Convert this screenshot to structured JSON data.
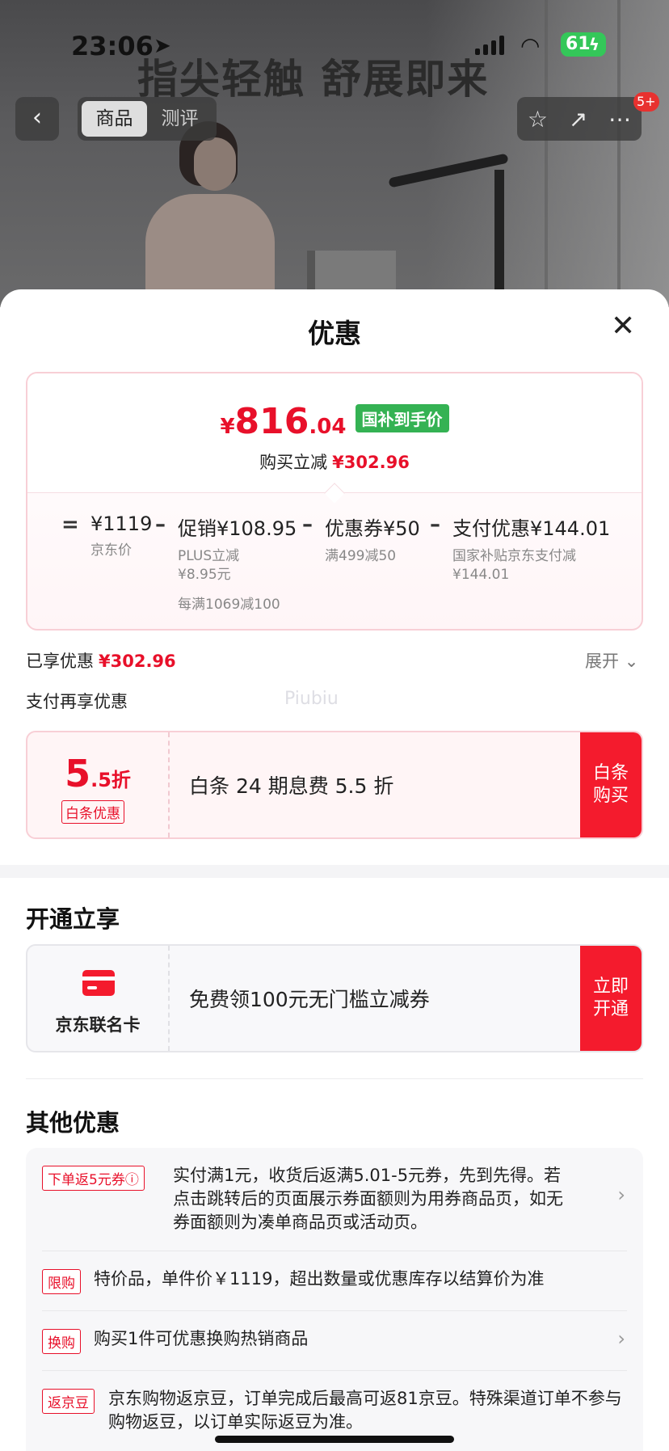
{
  "status_bar": {
    "time": "23:06",
    "battery": "61"
  },
  "hero": {
    "headline": "指尖轻触 舒展即来"
  },
  "nav": {
    "tabs": [
      {
        "label": "商品"
      },
      {
        "label": "测评"
      }
    ],
    "badge": "5+"
  },
  "sheet": {
    "title": "优惠",
    "price": {
      "currency": "¥",
      "integer": "816",
      "decimal": ".04",
      "tag": "国补到手价",
      "sub_label": "购买立减",
      "sub_amount": "¥302.96"
    },
    "breakdown": {
      "eq": "=",
      "base": {
        "main": "¥1119",
        "sub": "京东价"
      },
      "promo": {
        "op": "–",
        "main": "促销¥108.95",
        "sub_line1": "PLUS立减",
        "sub_line2": "¥8.95元",
        "sub_extra": "每满1069减100"
      },
      "coupon": {
        "op": "–",
        "main": "优惠券¥50",
        "sub": "满499减50"
      },
      "pay": {
        "op": "–",
        "main": "支付优惠¥144.01",
        "sub_line1": "国家补贴京东支付减",
        "sub_line2": "¥144.01"
      }
    },
    "enjoyed": {
      "label": "已享优惠",
      "amount": "¥302.96",
      "expand": "展开"
    },
    "pay_again": "支付再享优惠",
    "watermark": "Piubiu",
    "baitiao": {
      "num_big": "5",
      "num_small": ".5折",
      "tag": "白条优惠",
      "desc": "白条 24 期息费 5.5 折",
      "cta_line1": "白条",
      "cta_line2": "购买"
    },
    "open_section": {
      "title": "开通立享",
      "card_name": "京东联名卡",
      "desc": "免费领100元无门槛立减券",
      "cta_line1": "立即",
      "cta_line2": "开通"
    },
    "other_section": {
      "title": "其他优惠",
      "items": [
        {
          "tag": "下单返5元券ⓘ",
          "text": "实付满1元，收货后返满5.01-5元券，先到先得。若点击跳转后的页面展示券面额则为用券商品页，如无券面额则为凑单商品页或活动页。",
          "arrow": "›"
        },
        {
          "tag": "限购",
          "text": "特价品，单件价￥1119，超出数量或优惠库存以结算价为准",
          "arrow": ""
        },
        {
          "tag": "换购",
          "text": "购买1件可优惠换购热销商品",
          "arrow": "›"
        },
        {
          "tag": "返京豆",
          "text": "京东购物返京豆，订单完成后最高可返81京豆。特殊渠道订单不参与购物返豆，以订单实际返豆为准。",
          "arrow": ""
        }
      ]
    }
  }
}
